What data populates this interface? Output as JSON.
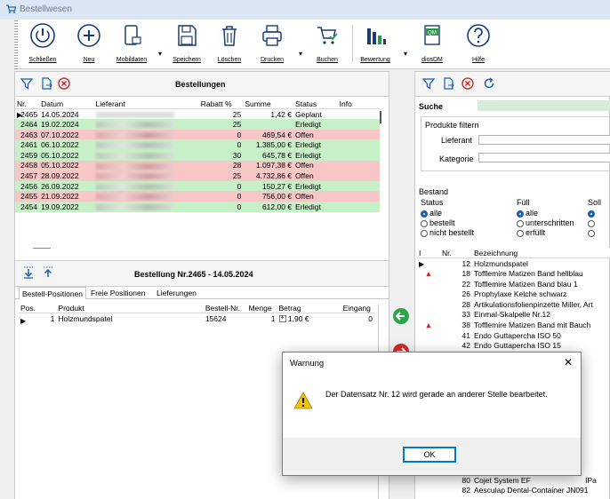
{
  "window": {
    "title": "Bestellwesen"
  },
  "toolbar": {
    "close": "Schließen",
    "new": "Neu",
    "mobile": "Mobildaten",
    "save": "Speichern",
    "delete": "Löschen",
    "print": "Drucken",
    "book": "Buchen",
    "rating": "Bewertung",
    "dm": "diosDM",
    "help": "Hilfe",
    "dm_icon_text": "QM"
  },
  "orders": {
    "title": "Bestellungen",
    "columns": [
      "Nr.",
      "Datum",
      "Lieferant",
      "Rabatt %",
      "Summe",
      "Status",
      "Info"
    ],
    "rows": [
      {
        "nr": "2465",
        "date": "14.05.2024",
        "rabatt": "25",
        "summe": "1,42 €",
        "status": "Geplant"
      },
      {
        "nr": "2464",
        "date": "19.02.2024",
        "rabatt": "25",
        "summe": "",
        "status": "Erledigt"
      },
      {
        "nr": "2463",
        "date": "07.10.2022",
        "rabatt": "0",
        "summe": "469,54 €",
        "status": "Offen"
      },
      {
        "nr": "2461",
        "date": "06.10.2022",
        "rabatt": "0",
        "summe": "1.385,00 €",
        "status": "Erledigt"
      },
      {
        "nr": "2459",
        "date": "05.10.2022",
        "rabatt": "30",
        "summe": "645,78 €",
        "status": "Erledigt"
      },
      {
        "nr": "2458",
        "date": "05.10.2022",
        "rabatt": "28",
        "summe": "1.097,38 €",
        "status": "Offen"
      },
      {
        "nr": "2457",
        "date": "28.09.2022",
        "rabatt": "25",
        "summe": "4.732,86 €",
        "status": "Offen"
      },
      {
        "nr": "2456",
        "date": "26.09.2022",
        "rabatt": "0",
        "summe": "150,27 €",
        "status": "Erledigt"
      },
      {
        "nr": "2455",
        "date": "21.09.2022",
        "rabatt": "0",
        "summe": "756,00 €",
        "status": "Offen"
      },
      {
        "nr": "2454",
        "date": "19.09.2022",
        "rabatt": "0",
        "summe": "612,00 €",
        "status": "Erledigt"
      }
    ]
  },
  "order_detail": {
    "title": "Bestellung Nr.2465 - 14.05.2024",
    "tabs": [
      "Bestell-Positionen",
      "Freie Positionen",
      "Lieferungen"
    ],
    "columns": [
      "Pos.",
      "Produkt",
      "Bestell-Nr.",
      "Menge",
      "Betrag",
      "Eingang"
    ],
    "rows": [
      {
        "pos": "1",
        "produkt": "Holzmundspatel",
        "bestellnr": "15624",
        "menge": "1",
        "betrag": "1,90 €",
        "eingang": "0"
      }
    ]
  },
  "right_panel": {
    "search_label": "Suche",
    "filter_title": "Produkte filtern",
    "supplier_label": "Lieferant",
    "category_label": "Kategorie",
    "stock_title": "Bestand",
    "status_title": "Status",
    "status_options": [
      "alle",
      "bestellt",
      "nicht bestellt"
    ],
    "fill_title": "Füll",
    "fill_options": [
      "alle",
      "unterschritten",
      "erfüllt"
    ],
    "soll_title": "Soll",
    "columns": [
      "I",
      "Nr.",
      "Bezeichnung"
    ],
    "products": [
      {
        "nr": "12",
        "name": "Holzmundspatel",
        "warn": false
      },
      {
        "nr": "18",
        "name": "Tofflemire Matizen Band hellblau",
        "warn": true
      },
      {
        "nr": "22",
        "name": "Tofflemire Matizen Band blau 1",
        "warn": false
      },
      {
        "nr": "26",
        "name": "Prophylaxe Kelche schwarz",
        "warn": false
      },
      {
        "nr": "28",
        "name": "Artikulationsfolienpinzette Miller, Art",
        "warn": false
      },
      {
        "nr": "33",
        "name": "Einmal-Skalpelle Nr.12",
        "warn": false
      },
      {
        "nr": "38",
        "name": "Tofflemire Matizen Band mit Bauch",
        "warn": true
      },
      {
        "nr": "41",
        "name": "Endo Guttapercha ISO 50",
        "warn": false
      },
      {
        "nr": "42",
        "name": "Endo Guttapercha ISO 15",
        "warn": false
      }
    ],
    "bottom_products": [
      {
        "nr": "80",
        "name": "Cojet System EF",
        "extra": "IPa"
      },
      {
        "nr": "82",
        "name": "Aesculap Dental-Container JN091",
        "extra": ""
      }
    ]
  },
  "dialog": {
    "title": "Warnung",
    "message": "Der Datensatz Nr. 12 wird gerade an anderer Stelle bearbeitet.",
    "ok": "OK"
  },
  "colors": {
    "green_row": "#c8f0c8",
    "red_row": "#f7c6c6",
    "accent": "#1a5fb4"
  }
}
